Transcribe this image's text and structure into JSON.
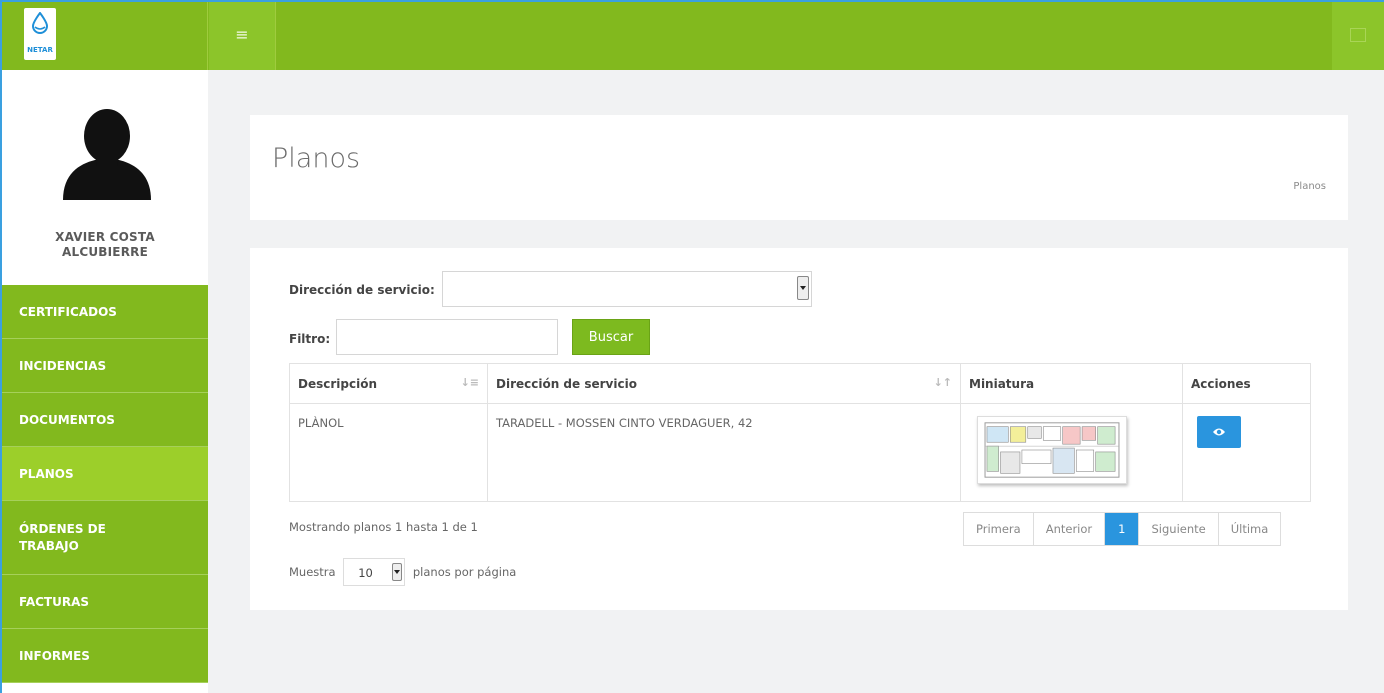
{
  "app": {
    "brand": "NETAR",
    "accent": "#82b91e",
    "active_nav": "#9ccf2a",
    "link_blue": "#2a95de"
  },
  "user": {
    "name_line1": "XAVIER COSTA",
    "name_line2": "ALCUBIERRE"
  },
  "nav": {
    "items": [
      {
        "label": "CERTIFICADOS"
      },
      {
        "label": "INCIDENCIAS"
      },
      {
        "label": "DOCUMENTOS"
      },
      {
        "label": "PLANOS",
        "active": true
      },
      {
        "label_line1": "ÓRDENES DE",
        "label_line2": "TRABAJO"
      },
      {
        "label": "FACTURAS"
      },
      {
        "label": "INFORMES"
      }
    ]
  },
  "header": {
    "title": "Planos",
    "breadcrumb": "Planos"
  },
  "filters": {
    "service_label": "Dirección de servicio:",
    "service_value": "",
    "filter_label": "Filtro:",
    "filter_value": "",
    "search_button": "Buscar"
  },
  "table": {
    "columns": [
      "Descripción",
      "Dirección de servicio",
      "Miniatura",
      "Acciones"
    ],
    "rows": [
      {
        "descripcion": "PLÀNOL",
        "direccion": "TARADELL - MOSSEN CINTO VERDAGUER, 42",
        "thumbnail_icon": "floor-plan-thumbnail",
        "action_icon": "eye-icon"
      }
    ]
  },
  "pagination": {
    "info": "Mostrando planos 1 hasta 1 de 1",
    "first": "Primera",
    "prev": "Anterior",
    "current": "1",
    "next": "Siguiente",
    "last": "Última"
  },
  "perpage": {
    "prefix": "Muestra",
    "value": "10",
    "suffix": "planos por página"
  }
}
